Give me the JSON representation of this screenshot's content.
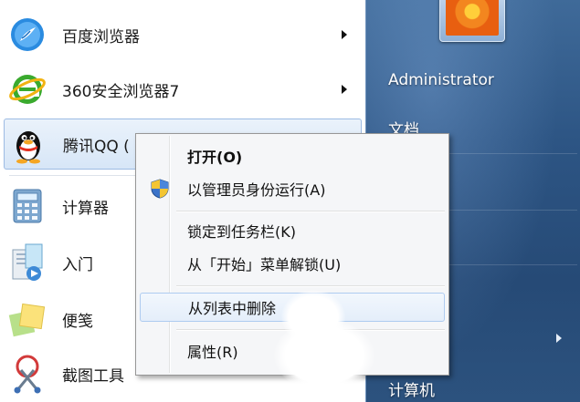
{
  "programs": [
    {
      "label": "百度浏览器",
      "icon": "baidu-browser-icon",
      "has_arrow": true
    },
    {
      "label": "360安全浏览器7",
      "icon": "360-browser-icon",
      "has_arrow": true
    },
    {
      "label": "腾讯QQ (",
      "icon": "qq-penguin-icon",
      "has_arrow": false
    },
    {
      "label": "计算器",
      "icon": "calculator-icon",
      "has_arrow": false
    },
    {
      "label": "入门",
      "icon": "getting-started-icon",
      "has_arrow": false
    },
    {
      "label": "便笺",
      "icon": "sticky-notes-icon",
      "has_arrow": false
    },
    {
      "label": "截图工具",
      "icon": "snipping-tool-icon",
      "has_arrow": false
    }
  ],
  "right_pane": {
    "user_name": "Administrator",
    "documents_partial": "文档",
    "computer_partial": "计算机"
  },
  "context_menu": {
    "items": [
      {
        "label": "打开(O)",
        "bold": true
      },
      {
        "label": "以管理员身份运行(A)",
        "icon": "uac-shield-icon"
      },
      {
        "label": "锁定到任务栏(K)"
      },
      {
        "label": "从「开始」菜单解锁(U)"
      },
      {
        "label": "从列表中删除",
        "highlighted": true
      },
      {
        "label": "属性(R)"
      }
    ]
  },
  "colors": {
    "start_menu_blue": "#2d5584",
    "menu_highlight_border": "#aecbf0",
    "program_hover": "#d7e6f7"
  }
}
